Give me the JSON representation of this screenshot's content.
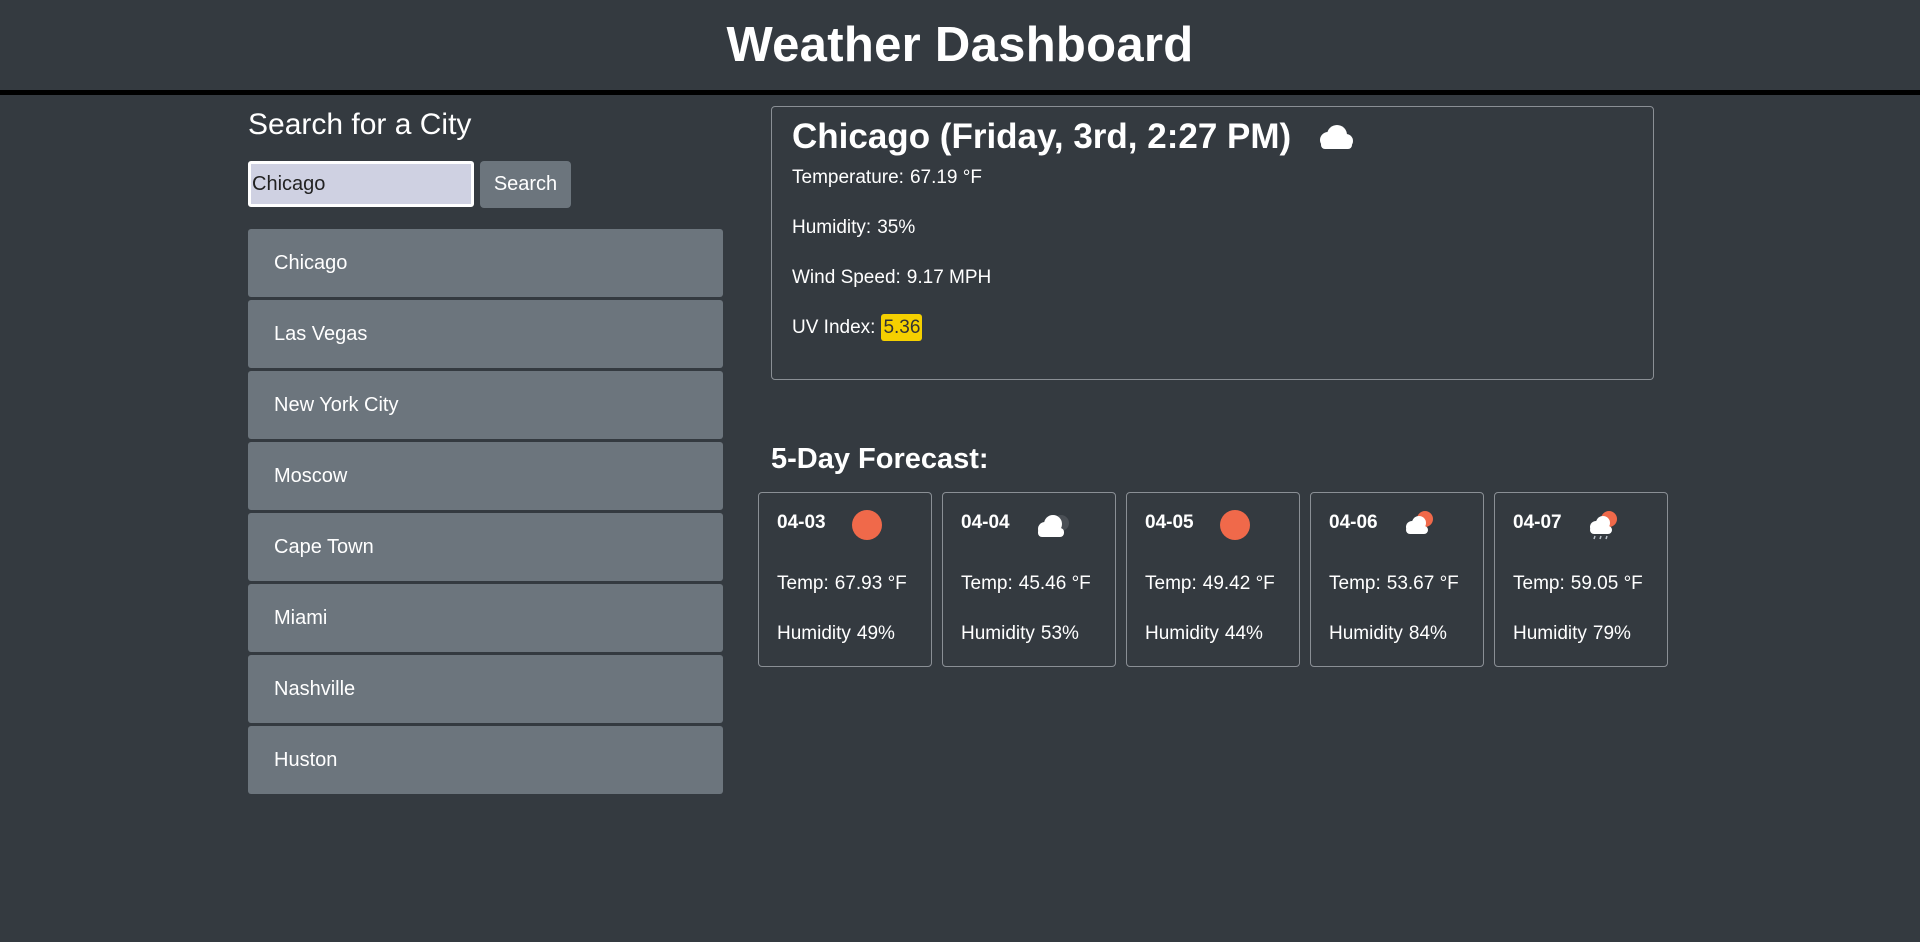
{
  "header": {
    "title": "Weather Dashboard"
  },
  "search": {
    "title": "Search for a City",
    "input_value": "Chicago",
    "button_label": "Search"
  },
  "history": [
    "Chicago",
    "Las Vegas",
    "New York City",
    "Moscow",
    "Cape Town",
    "Miami",
    "Nashville",
    "Huston"
  ],
  "current": {
    "heading": "Chicago (Friday, 3rd, 2:27 PM)",
    "icon": "cloud-icon",
    "temperature_label": "Temperature:",
    "temperature": "67.19 °F",
    "humidity_label": "Humidity:",
    "humidity": "35%",
    "wind_label": "Wind Speed:",
    "wind": "9.17 MPH",
    "uv_label": "UV Index:",
    "uv": "5.36",
    "uv_color": "#f5d000"
  },
  "forecast": {
    "title": "5-Day Forecast:",
    "temp_label": "Temp:",
    "humidity_label": "Humidity",
    "days": [
      {
        "date": "04-03",
        "icon": "sun-icon",
        "temp": "67.93 °F",
        "humidity": "49%"
      },
      {
        "date": "04-04",
        "icon": "cloud-icon",
        "temp": "45.46 °F",
        "humidity": "53%"
      },
      {
        "date": "04-05",
        "icon": "sun-icon",
        "temp": "49.42 °F",
        "humidity": "44%"
      },
      {
        "date": "04-06",
        "icon": "partly-cloudy-icon",
        "temp": "53.67 °F",
        "humidity": "84%"
      },
      {
        "date": "04-07",
        "icon": "rain-sun-icon",
        "temp": "59.05 °F",
        "humidity": "79%"
      }
    ]
  },
  "colors": {
    "background": "#343a40",
    "panel": "#6c757d",
    "sun": "#f0694a",
    "uv": "#f5d000"
  }
}
